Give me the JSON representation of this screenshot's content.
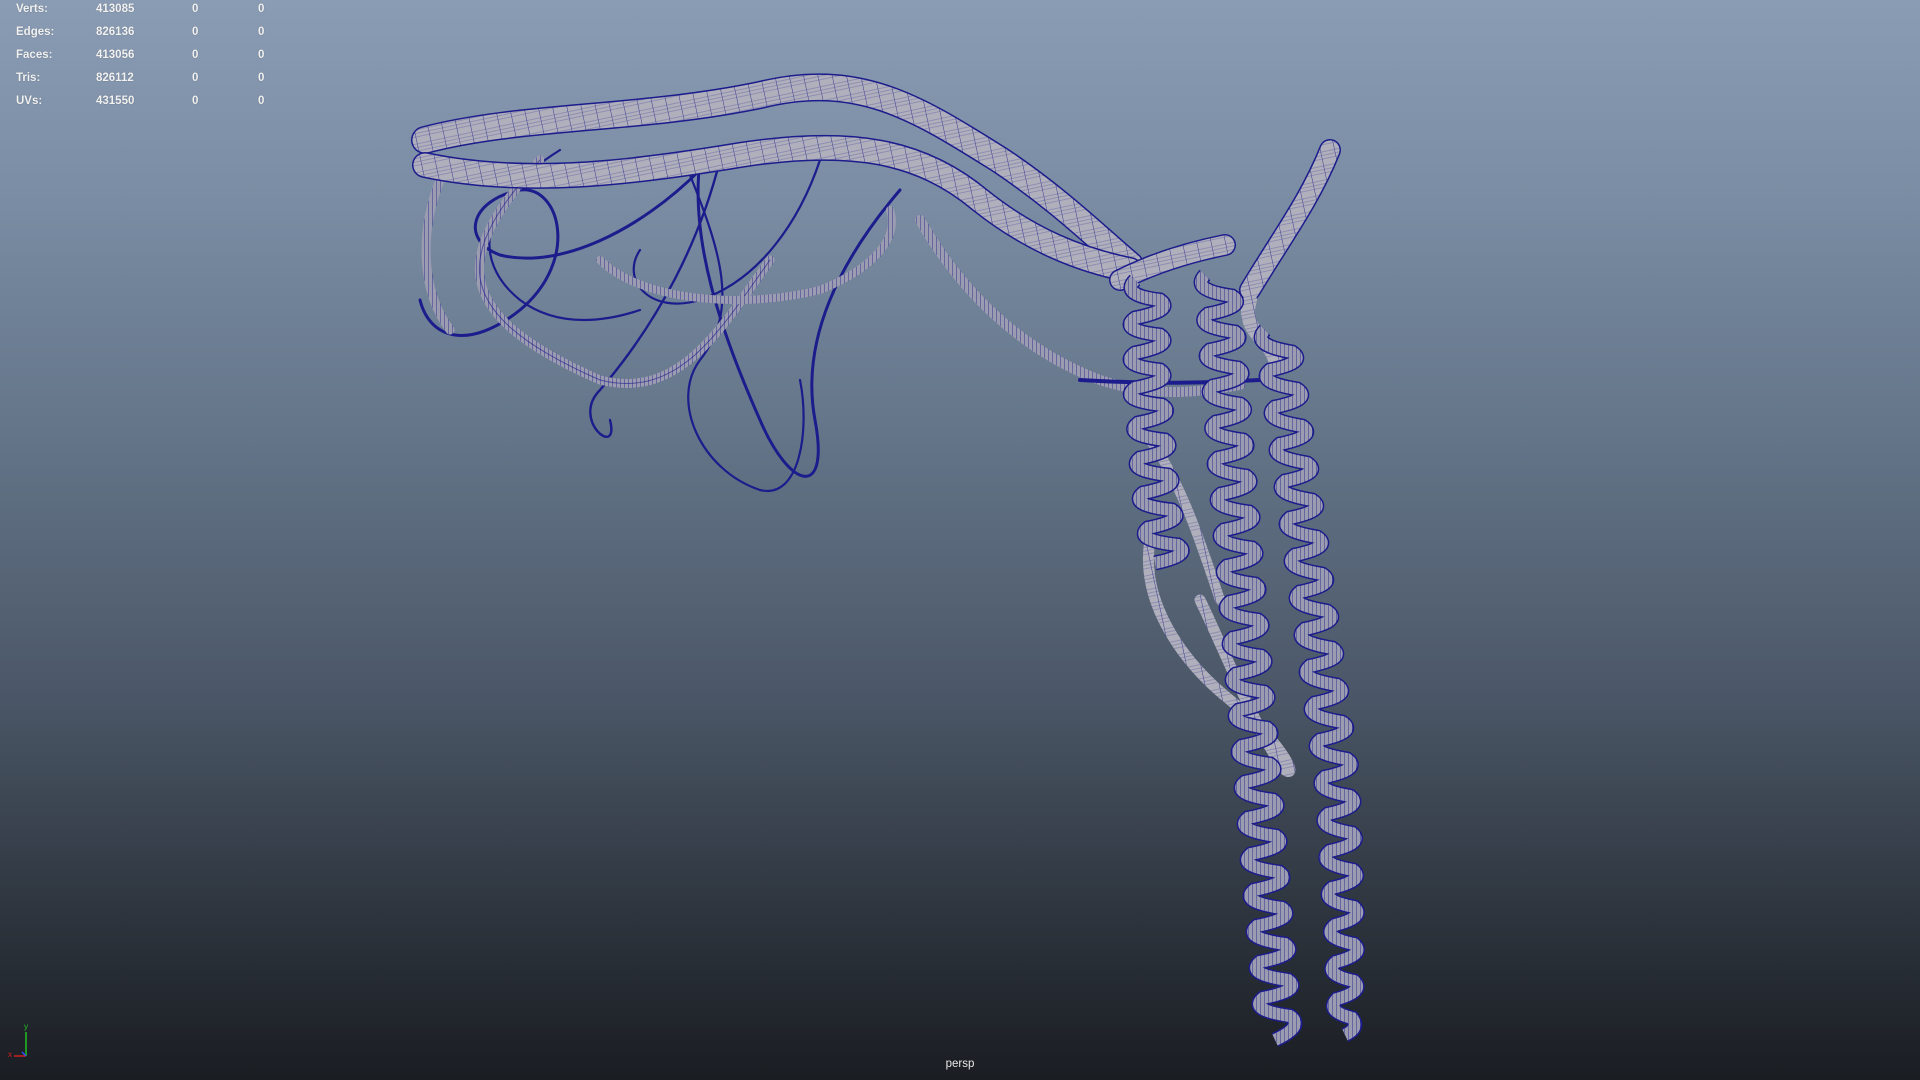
{
  "hud": {
    "rows": [
      {
        "label": "Verts:",
        "v1": "413085",
        "v2": "0",
        "v3": "0"
      },
      {
        "label": "Edges:",
        "v1": "826136",
        "v2": "0",
        "v3": "0"
      },
      {
        "label": "Faces:",
        "v1": "413056",
        "v2": "0",
        "v3": "0"
      },
      {
        "label": "Tris:",
        "v1": "826112",
        "v2": "0",
        "v3": "0"
      },
      {
        "label": "UVs:",
        "v1": "431550",
        "v2": "0",
        "v3": "0"
      }
    ]
  },
  "viewport": {
    "camera_label": "persp",
    "wire_color": "#1c1c8c",
    "ribbon_fill": "#a8a8b4"
  },
  "axis": {
    "x_label": "x",
    "y_label": "y",
    "x_color": "#d02020",
    "y_color": "#20c020"
  }
}
